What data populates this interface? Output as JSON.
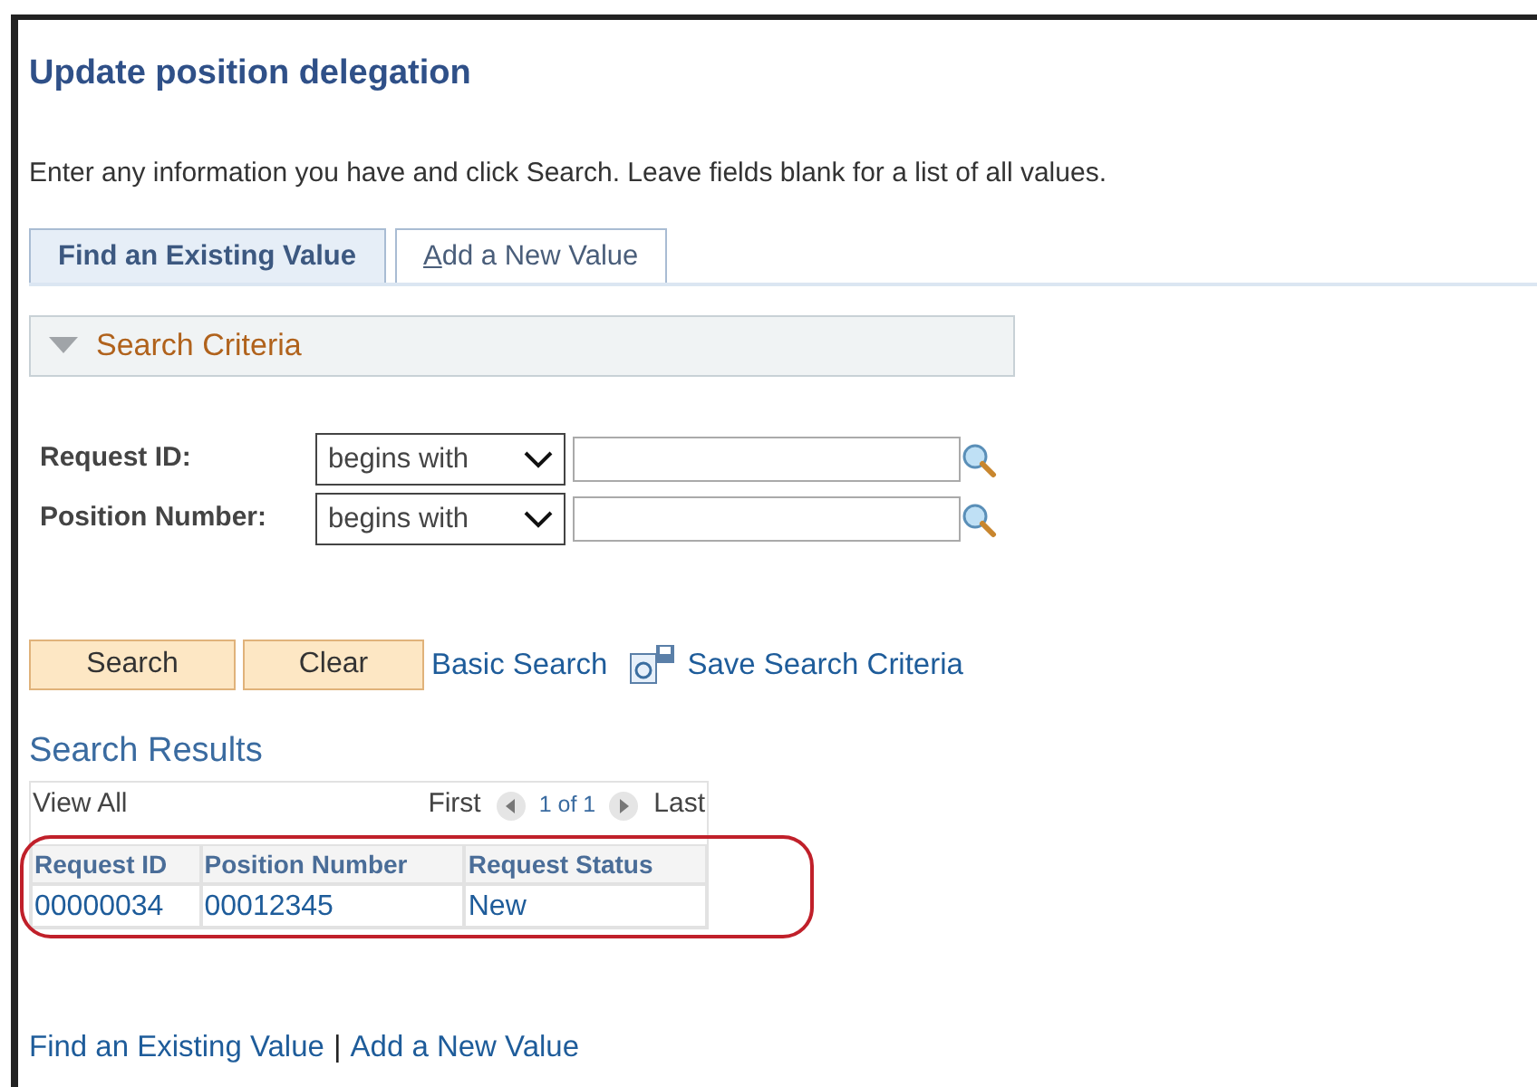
{
  "title": "Update position delegation",
  "instructions": "Enter any information you have and click Search. Leave fields blank for a list of all values.",
  "tabs": [
    {
      "label": "Find an Existing Value",
      "selected": true
    },
    {
      "label": "Add a New Value",
      "selected": false
    }
  ],
  "criteria": {
    "label": "Search Criteria",
    "expanded": true
  },
  "fields": [
    {
      "label": "Request ID:",
      "operator": "begins with"
    },
    {
      "label": "Position Number:",
      "operator": "begins with"
    }
  ],
  "buttons": [
    "Search",
    "Clear"
  ],
  "links": {
    "basic": "Basic Search",
    "save": "Save Search Criteria"
  },
  "results": {
    "title": "Search Results",
    "view_all": "View All",
    "first": "First",
    "page": "1 of 1",
    "last": "Last",
    "columns": [
      "Request ID",
      "Position Number",
      "Request Status"
    ],
    "rows": [
      [
        "00000034",
        "00012345",
        "New"
      ]
    ]
  },
  "bottom_links": [
    "Find an Existing Value",
    "Add a New Value"
  ],
  "separator": "|"
}
